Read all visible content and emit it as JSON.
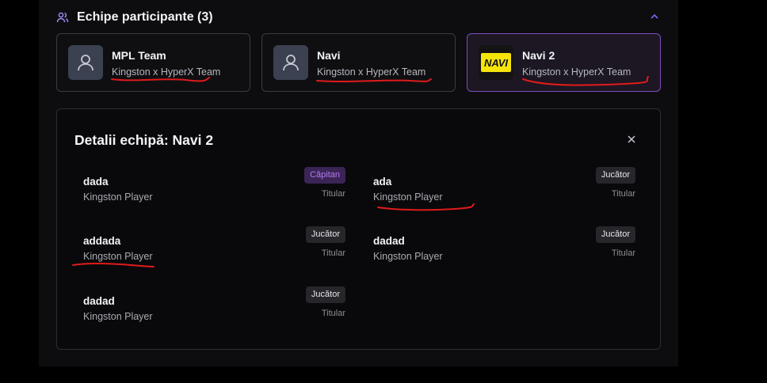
{
  "section": {
    "title": "Echipe participante (3)",
    "icon": "users-icon",
    "toggle_icon": "chevron-up-icon"
  },
  "teams": [
    {
      "name": "MPL Team",
      "subtitle": "Kingston x HyperX Team",
      "avatar": "user-placeholder-icon"
    },
    {
      "name": "Navi",
      "subtitle": "Kingston x HyperX Team",
      "avatar": "user-placeholder-icon"
    },
    {
      "name": "Navi 2",
      "subtitle": "Kingston x HyperX Team",
      "avatar": "navi-logo",
      "logo_text": "NAVI",
      "selected": true
    }
  ],
  "details": {
    "heading": "Detalii echipă: Navi 2",
    "close_icon": "close-icon",
    "players": [
      {
        "name": "dada",
        "team": "Kingston Player",
        "badge": "Căpitan",
        "role": "Titular"
      },
      {
        "name": "ada",
        "team": "Kingston Player",
        "badge": "Jucător",
        "role": "Titular"
      },
      {
        "name": "addada",
        "team": "Kingston Player",
        "badge": "Jucător",
        "role": "Titular"
      },
      {
        "name": "dadad",
        "team": "Kingston Player",
        "badge": "Jucător",
        "role": "Titular"
      },
      {
        "name": "dadad",
        "team": "Kingston Player",
        "badge": "Jucător",
        "role": "Titular"
      }
    ]
  },
  "colors": {
    "accent": "#7c4dbf",
    "captain_badge": "#b57cf2",
    "annotation": "#e01b1b"
  }
}
